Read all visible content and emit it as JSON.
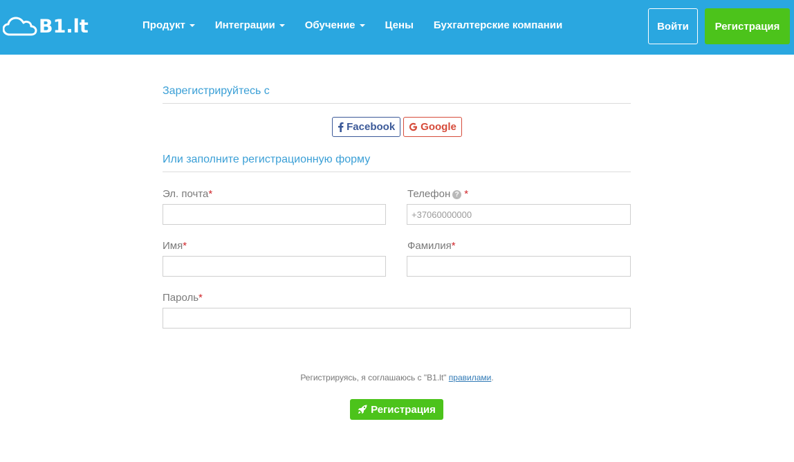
{
  "header": {
    "logo_text": "B1.lt",
    "nav": [
      {
        "label": "Продукт",
        "dropdown": true
      },
      {
        "label": "Интеграции",
        "dropdown": true
      },
      {
        "label": "Обучение",
        "dropdown": true
      },
      {
        "label": "Цены",
        "dropdown": false
      },
      {
        "label": "Бухгалтерские компании",
        "dropdown": false
      }
    ],
    "login_label": "Войти",
    "register_label": "Регистрация"
  },
  "social_section": {
    "title": "Зарегистрируйтесь с",
    "facebook_label": "Facebook",
    "google_label": "Google"
  },
  "form": {
    "title": "Или заполните регистрационную форму",
    "email_label": "Эл. почта",
    "email_value": "",
    "phone_label": "Телефон",
    "phone_placeholder": "+37060000000",
    "first_name_label": "Имя",
    "first_name_value": "",
    "last_name_label": "Фамилия",
    "last_name_value": "",
    "password_label": "Пароль",
    "password_value": "",
    "required_mark": "*"
  },
  "agreement": {
    "text": "Регистрируясь, я соглашаюсь с \"B1.lt\"",
    "link_label": "правилами",
    "end": "."
  },
  "submit_label": "Регистрация",
  "colors": {
    "header_bg": "#2aa7e0",
    "accent_green": "#4cc31b",
    "title_blue": "#3a9fd6",
    "facebook": "#3b5998",
    "google": "#d64b3a",
    "required": "#d0272c"
  },
  "icons": {
    "logo": "cloud-icon",
    "facebook": "facebook-icon",
    "google": "google-icon",
    "help": "question-circle-icon",
    "submit": "rocket-icon",
    "dropdown": "caret-down-icon"
  }
}
